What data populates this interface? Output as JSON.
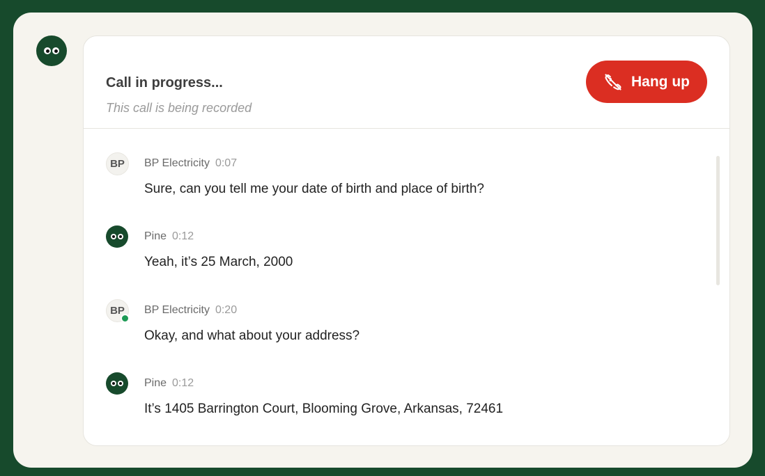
{
  "header": {
    "title": "Call in progress...",
    "subtitle": "This call is being recorded",
    "hangup_label": "Hang up"
  },
  "transcript": [
    {
      "speaker": "BP Electricity",
      "avatar_text": "BP",
      "time": "0:07",
      "text": "Sure, can you tell me your date of birth and place of birth?"
    },
    {
      "speaker": "Pine",
      "time": "0:12",
      "text": "Yeah, it’s 25 March, 2000"
    },
    {
      "speaker": "BP Electricity",
      "avatar_text": "BP",
      "time": "0:20",
      "text": "Okay, and what about your address?"
    },
    {
      "speaker": "Pine",
      "time": "0:12",
      "text": "It’s 1405 Barrington Court, Blooming Grove, Arkansas, 72461"
    }
  ],
  "icons": {
    "hangup": "phone-hangup-icon",
    "assistant": "pine-eyes-icon"
  },
  "colors": {
    "brand_green": "#174a2c",
    "hangup_red": "#db2e22",
    "online_green": "#1d9a55",
    "background": "#f6f4ee"
  }
}
